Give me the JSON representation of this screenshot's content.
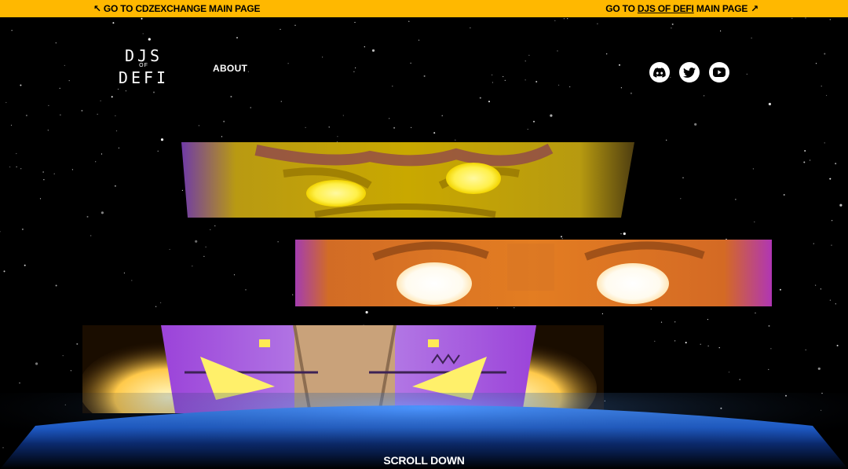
{
  "topbar": {
    "left_arrow": "↖",
    "left_label": "GO TO CDZEXCHANGE MAIN PAGE",
    "right_prefix": "GO TO ",
    "right_link": "DJS OF DEFI",
    "right_suffix": " MAIN PAGE",
    "right_arrow": "↗",
    "color": "#ffb800"
  },
  "logo": {
    "line1": "DJS",
    "line2": "OF",
    "line3": "DEFI"
  },
  "nav": {
    "about": "ABOUT"
  },
  "social": [
    {
      "icon": "discord-icon"
    },
    {
      "icon": "twitter-icon"
    },
    {
      "icon": "youtube-icon"
    }
  ],
  "panels": [
    {
      "icon": "yellow-character-eyes",
      "color": "#c9a800"
    },
    {
      "icon": "orange-character-eyes",
      "color": "#e37d22"
    },
    {
      "icon": "purple-robot-eyes",
      "color": "#9b43d9"
    }
  ],
  "planet": {
    "color": "#1f5fd0"
  },
  "footer": {
    "scroll_down": "SCROLL DOWN"
  }
}
